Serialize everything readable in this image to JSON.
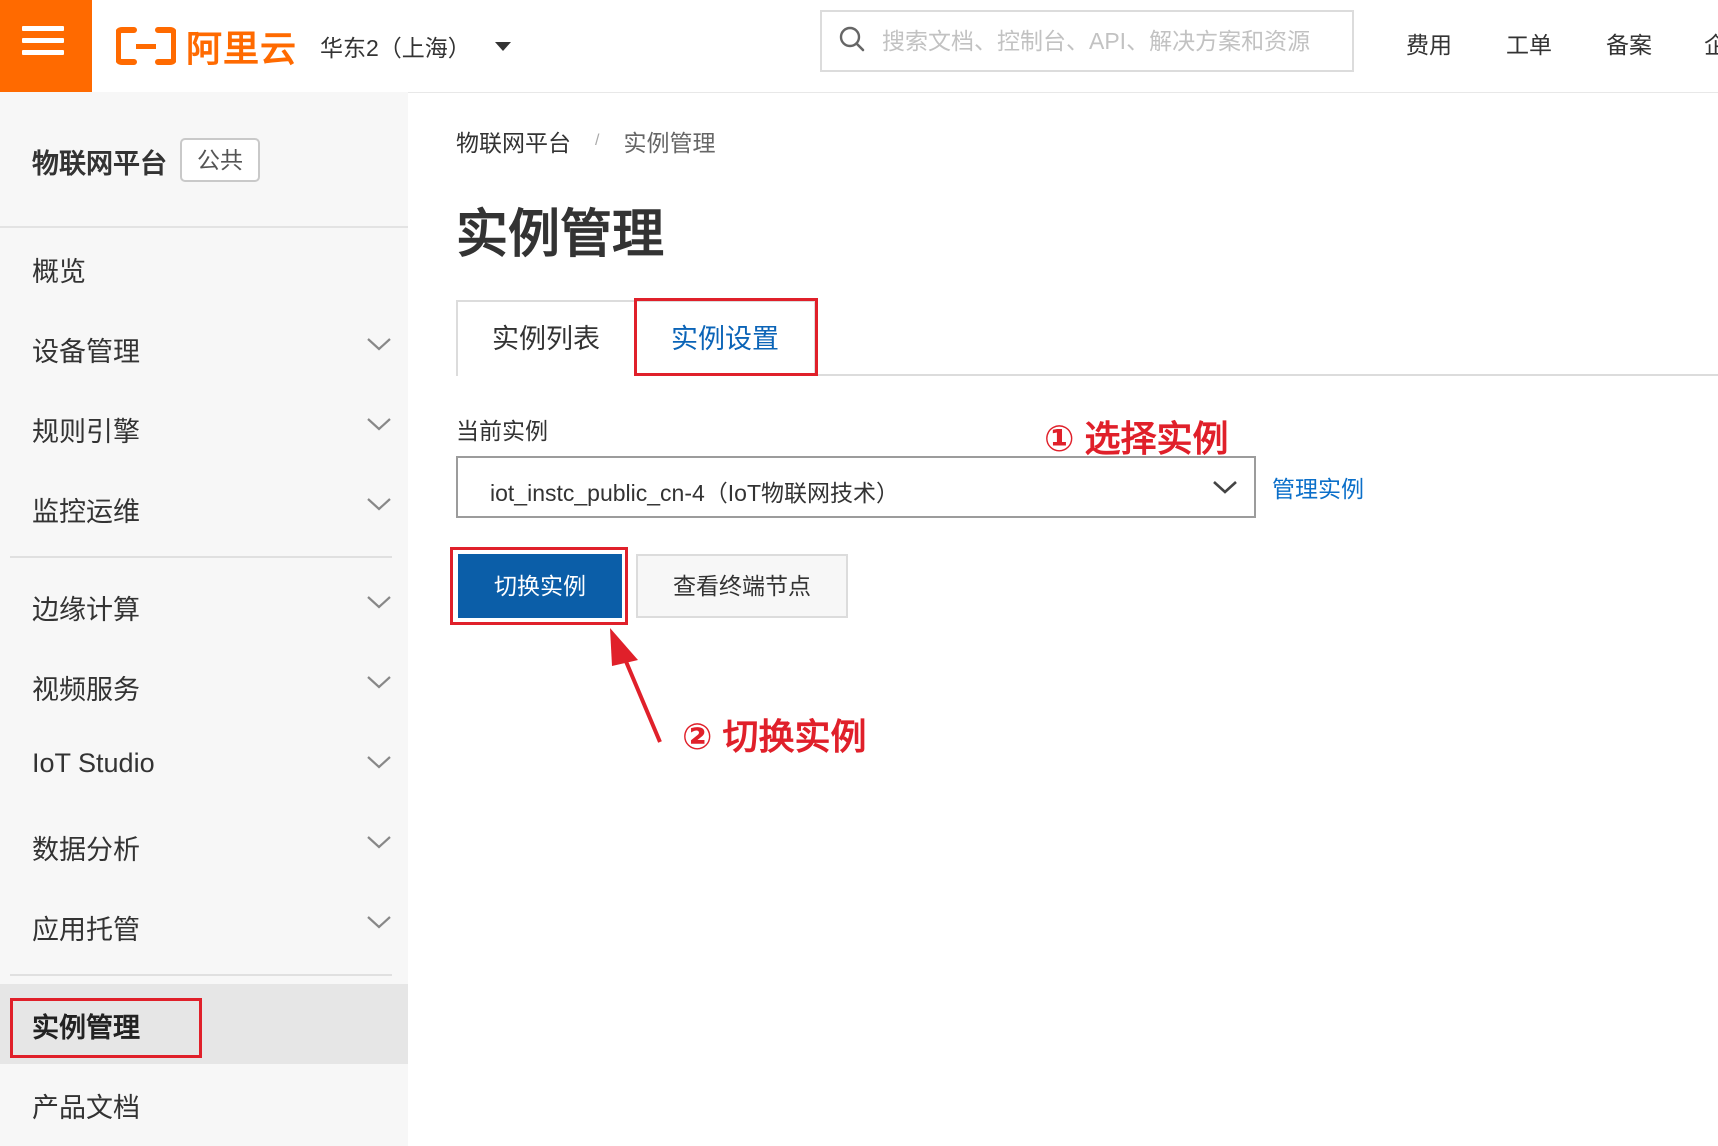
{
  "header": {
    "logo_text": "阿里云",
    "region": "华东2（上海）",
    "search_placeholder": "搜索文档、控制台、API、解决方案和资源",
    "nav": [
      "费用",
      "工单",
      "备案",
      "企"
    ]
  },
  "sidebar": {
    "title": "物联网平台",
    "badge": "公共",
    "items": [
      {
        "label": "概览"
      },
      {
        "label": "设备管理"
      },
      {
        "label": "规则引擎"
      },
      {
        "label": "监控运维"
      },
      {
        "label": "边缘计算"
      },
      {
        "label": "视频服务"
      },
      {
        "label": "IoT Studio"
      },
      {
        "label": "数据分析"
      },
      {
        "label": "应用托管"
      },
      {
        "label": "实例管理"
      },
      {
        "label": "产品文档"
      }
    ]
  },
  "main": {
    "breadcrumb": [
      "物联网平台",
      "实例管理"
    ],
    "breadcrumb_sep": "/",
    "title": "实例管理",
    "tabs": [
      {
        "label": "实例列表"
      },
      {
        "label": "实例设置"
      }
    ],
    "current_instance_label": "当前实例",
    "current_instance_value": "iot_instc_public_cn-4（IoT物联网技术）",
    "manage_link": "管理实例",
    "switch_button": "切换实例",
    "view_nodes_button": "查看终端节点"
  },
  "annotations": {
    "step1": "① 选择实例",
    "step2": "② 切换实例",
    "color": "#e0202a"
  },
  "colors": {
    "brand": "#ff6a00",
    "primary": "#0b5ea8",
    "link": "#0b6fc9"
  }
}
